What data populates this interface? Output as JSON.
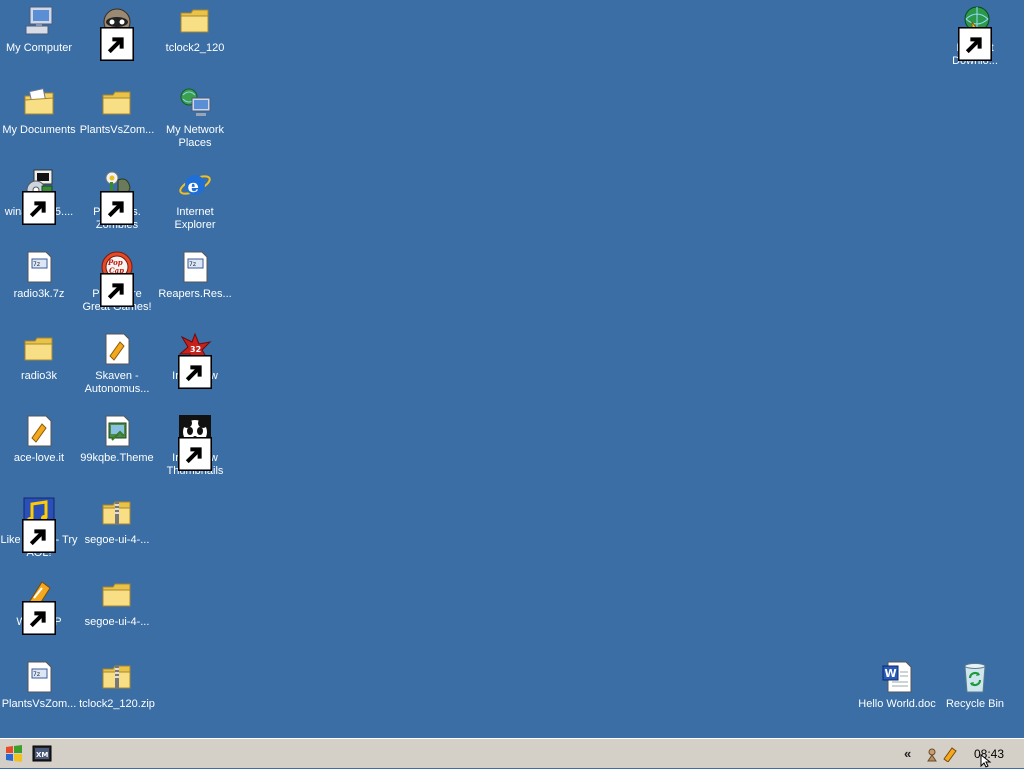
{
  "desktop": {
    "background_color": "#3a6ea5",
    "icons": [
      {
        "label": "My Computer",
        "icon": "my-computer-icon"
      },
      {
        "label": "Mypal",
        "icon": "mypal-icon"
      },
      {
        "label": "tclock2_120",
        "icon": "folder-icon"
      },
      {
        "label": "Internet Downlo...",
        "icon": "internet-download-icon"
      },
      {
        "label": "My Documents",
        "icon": "my-documents-icon"
      },
      {
        "label": "PlantsVsZom...",
        "icon": "folder-icon"
      },
      {
        "label": "My Network Places",
        "icon": "network-places-icon"
      },
      {
        "label": "winamp295....",
        "icon": "installer-icon"
      },
      {
        "label": "Plants vs. Zombies",
        "icon": "pvz-icon"
      },
      {
        "label": "Internet Explorer",
        "icon": "ie-icon"
      },
      {
        "label": "radio3k.7z",
        "icon": "archive-file-icon"
      },
      {
        "label": "Play More Great Games!",
        "icon": "popcap-icon"
      },
      {
        "label": "Reapers.Res...",
        "icon": "archive-file-icon"
      },
      {
        "label": "radio3k",
        "icon": "folder-icon"
      },
      {
        "label": "Skaven - Autonomus...",
        "icon": "music-file-icon"
      },
      {
        "label": "IrfanView",
        "icon": "irfanview-icon"
      },
      {
        "label": "ace-love.it",
        "icon": "music-file-icon"
      },
      {
        "label": "99kqbe.Theme",
        "icon": "theme-file-icon"
      },
      {
        "label": "IrfanView Thumbnails",
        "icon": "irfanview-thumbnails-icon"
      },
      {
        "label": "Like Music - Try AOL!",
        "icon": "aol-music-icon"
      },
      {
        "label": "segoe-ui-4-...",
        "icon": "zip-folder-icon"
      },
      {
        "label": "WINAMP",
        "icon": "winamp-icon"
      },
      {
        "label": "segoe-ui-4-...",
        "icon": "folder-icon"
      },
      {
        "label": "PlantsVsZom...",
        "icon": "archive-file-icon"
      },
      {
        "label": "tclock2_120.zip",
        "icon": "zip-folder-icon"
      },
      {
        "label": "Hello World.doc",
        "icon": "word-document-icon"
      },
      {
        "label": "Recycle Bin",
        "icon": "recycle-bin-icon"
      }
    ]
  },
  "taskbar": {
    "start_icon": "windows-start-icon",
    "quick_launch_icon": "xm-app-icon",
    "tray_expand": "«",
    "tray_icons": [
      "tray-app-icon",
      "winamp-tray-icon"
    ],
    "clock": "08:43"
  }
}
